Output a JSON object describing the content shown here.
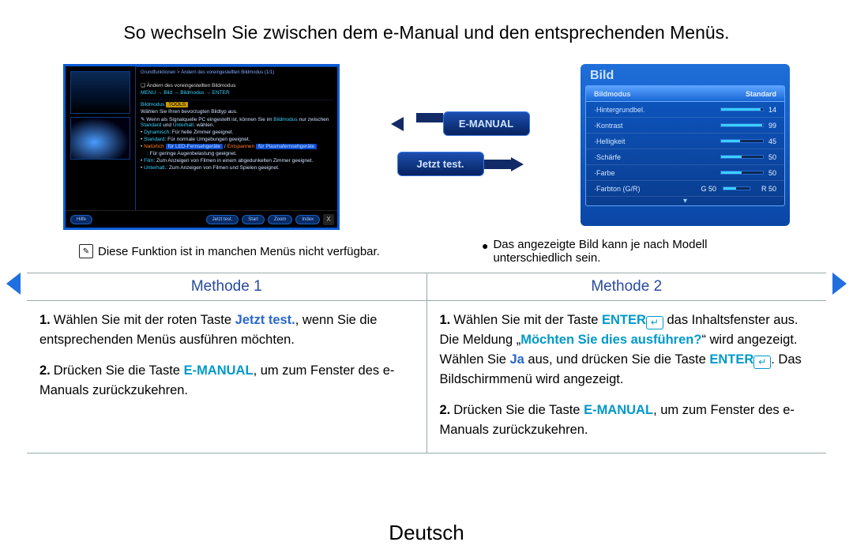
{
  "title": "So wechseln Sie zwischen dem e-Manual und den entsprechenden Menüs.",
  "language": "Deutsch",
  "emanual": {
    "breadcrumb": "Grundfunktionen > Ändern des voreingestellten Bildmodus (1/1)",
    "heading": "Ändern des voreingestellten Bildmodus",
    "menu_path": "MENU → Bild → Bildmodus → ENTER",
    "subhead": "Bildmodus",
    "tools_tag": "TOOLS",
    "desc1": "Wählen Sie Ihren bevorzugten Bildtyp aus.",
    "desc2a": "Wenn als Signalquelle PC eingestellt ist, können Sie im ",
    "desc2b": "Bildmodus",
    "desc2c": " nur zwischen ",
    "desc2d": "Standard",
    "desc2e": " und ",
    "desc2f": "Unterhalt.",
    "desc2g": " wählen.",
    "li1_label": "Dynamisch",
    "li1_text": ": Für helle Zimmer geeignet.",
    "li2_label": "Standard",
    "li2_text": ": Für normale Umgebungen geeignet.",
    "li3_label": "Natürlich",
    "li3_tag1": "für LED-Fernsehgeräte",
    "li3_sep": " / ",
    "li3_label2": "Entspannen",
    "li3_tag2": "für Plasmafernsehgeräte",
    "li3_text": ": Für geringe Augenbelastung geeignet.",
    "li4_label": "Film",
    "li4_text": ": Zum Anzeigen von Filmen in einem abgedunkelten Zimmer geeignet.",
    "li5_label": "Unterhalt.",
    "li5_text": ": Zum Anzeigen von Filmen und Spielen geeignet.",
    "footer": {
      "left": "Hilfe",
      "btn1": "Jetzt test.",
      "btn2": "Start",
      "btn3": "Zoom",
      "btn4": "Index",
      "close": "X"
    }
  },
  "center": {
    "btn_top": "E-MANUAL",
    "btn_bottom": "Jetzt test."
  },
  "bild": {
    "title": "Bild",
    "rows": [
      {
        "label": "Bildmodus",
        "value": "Standard"
      },
      {
        "label": "·Hintergrundbel.",
        "value": "14",
        "fill": 95
      },
      {
        "label": "·Kontrast",
        "value": "99",
        "fill": 99
      },
      {
        "label": "·Helligkeit",
        "value": "45",
        "fill": 45
      },
      {
        "label": "·Schärfe",
        "value": "50",
        "fill": 50
      },
      {
        "label": "·Farbe",
        "value": "50",
        "fill": 50
      },
      {
        "label": "·Farbton (G/R)",
        "value": "G 50",
        "value2": "R 50"
      }
    ]
  },
  "note_left": "Diese Funktion ist in manchen Menüs nicht verfügbar.",
  "note_right": "Das angezeigte Bild kann je nach Modell unterschiedlich sein.",
  "methods": {
    "h1": "Methode 1",
    "h2": "Methode 2",
    "m1_s1_a": "Wählen Sie mit der roten Taste ",
    "m1_s1_b": "Jetzt test.",
    "m1_s1_c": ", wenn Sie die entsprechenden Menüs ausführen möchten.",
    "m1_s2_a": "Drücken Sie die Taste ",
    "m1_s2_b": "E-MANUAL",
    "m1_s2_c": ", um zum Fenster des e-Manuals zurückzukehren.",
    "m2_s1_a": "Wählen Sie mit der Taste ",
    "m2_s1_b": "ENTER",
    "m2_s1_c": " das Inhaltsfenster aus. Die Meldung „",
    "m2_s1_d": "Möchten Sie dies ausführen?",
    "m2_s1_e": "“ wird angezeigt. Wählen Sie ",
    "m2_s1_f": "Ja",
    "m2_s1_g": " aus, und drücken Sie die Taste ",
    "m2_s1_h": "ENTER",
    "m2_s1_i": ". Das Bildschirmmenü wird angezeigt.",
    "m2_s2_a": "Drücken Sie die Taste ",
    "m2_s2_b": "E-MANUAL",
    "m2_s2_c": ", um zum Fenster des e-Manuals zurückzukehren."
  }
}
